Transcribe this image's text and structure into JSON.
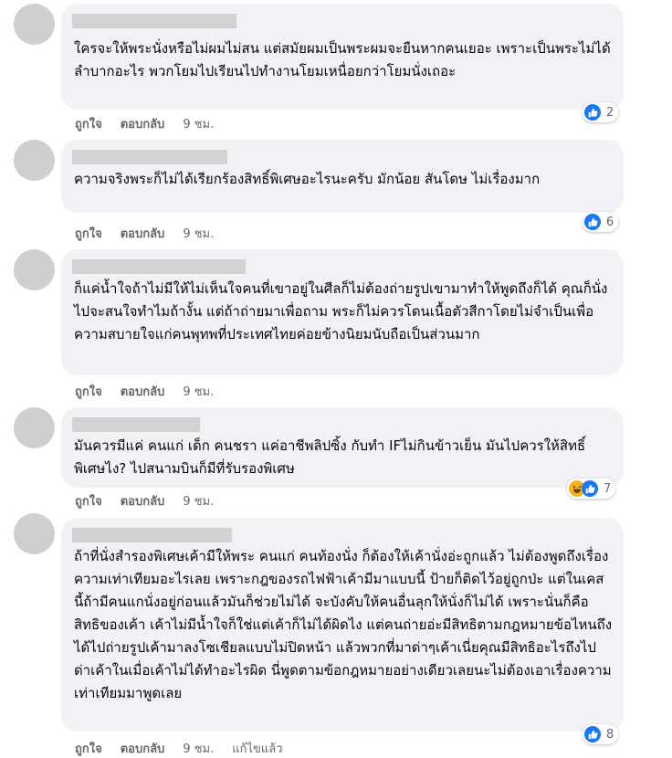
{
  "actions": {
    "like": "ถูกใจ",
    "reply": "ตอบกลับ",
    "edited": "แก้ไขแล้ว"
  },
  "comments": [
    {
      "text": "ใครจะให้พระนั่งหรือไม่ผมไม่สน แต่สมัยผมเป็นพระผมจะยืนหากคนเยอะ เพราะเป็นพระไม่ได้ลำบากอะไร พวกโยมไปเรียนไปทำงานโยมเหนื่อยกว่าโยมนั่งเถอะ",
      "time": "9 ชม.",
      "reactions": [
        "like-icon"
      ],
      "count": "2"
    },
    {
      "text": "ความจริงพระก็ไม่ได้เรียกร้องสิทธิ์พิเศษอะไรนะครับ มักน้อย สันโดษ ไม่เรื่องมาก",
      "time": "9 ชม.",
      "reactions": [
        "like-icon"
      ],
      "count": "6"
    },
    {
      "text": "ก็แค่น้ำใจถ้าไม่มีให้ไม่เห็นใจคนที่เขาอยู่ในศีลก็ไม่ต้องถ่ายรูปเขามาทำให้พูดถึงก็ได้ คุณก็นั่งไปจะสนใจทำไมถ้างั้น แต่ถ้าถ่ายมาเพื่อถาม พระก็ไม่ควรโดนเนื้อตัวสีกาโดยไม่จำเป็นเพื่อความสบายใจแก่คนพุทพที่ประเทศไทยค่อยข้างนิยมนับถือเป็นส่วนมาก",
      "time": "9 ชม."
    },
    {
      "text": "มันควรมีแค่ คนแก่ เด็ก คนชรา แค่อาชีพลิปซิ้ง กับทำ IFไม่กินข้าวเย็น มันไปควรให้สิทธิ์พิเศษไง? ไปสนามบินก็มีที่รับรองพิเศษ",
      "time": "9 ชม.",
      "reactions": [
        "haha-icon",
        "like-icon"
      ],
      "count": "7"
    },
    {
      "text": "ถ้าที่นั่งสำรองพิเศษเค้ามีให้พระ คนแก่ คนท้องนั่ง ก็ต้องให้เค้านั่งอ่ะถูกแล้ว ไม่ต้องพูดถึงเรื่องความเท่าเทียมอะไรเลย เพราะกฎของรถไฟฟ้าเค้ามีมาแบบนี้ ป้ายก็ติดไว้อยู่ถูกป่ะ แต่ในเคสนี้ถ้ามีคนแกนั่งอยู่ก่อนแล้วมันก็ช่วยไม่ได้ จะบังคับให้คนอื่นลุกให้นั่งก็ไม่ได้ เพราะนั่นก็คือสิทธิของเค้า เค้าไม่มีน้ำใจก็ใช่แต่เค้าก็ไม่ได้ผิดไง แต่คนถ่ายอ่ะมีสิทธิตามกฎหมายข้อไหนถึงได้ไปถ่ายรูปเค้ามาลงโซเชียลแบบไม่ปิดหน้า แล้วพวกที่มาด่าๆเค้าเนี่ยคุณมีสิทธิอะไรถึงไปด่าเค้าในเมื่อเค้าไม่ได้ทำอะไรผิด นี่พูดตามข้อกฎหมายอย่างเดียวเลยนะไม่ต้องเอาเรื่องความเท่าเทียมมาพูดเลย",
      "time": "9 ชม.",
      "edited": true,
      "reactions": [
        "like-icon"
      ],
      "count": "8"
    }
  ]
}
